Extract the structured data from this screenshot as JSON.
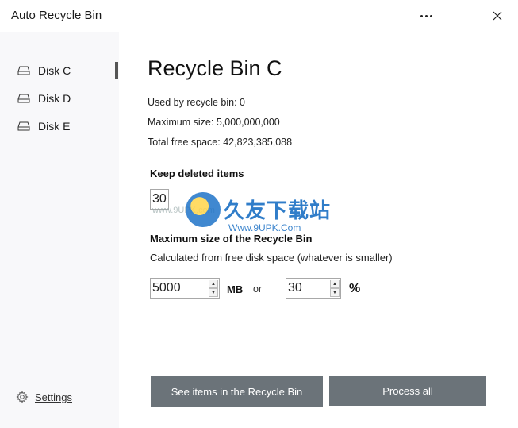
{
  "window": {
    "title": "Auto Recycle Bin",
    "more_icon": "more-horizontal-icon",
    "close_icon": "close-icon"
  },
  "sidebar": {
    "items": [
      {
        "label": "Disk C",
        "icon": "drive-icon",
        "active": true
      },
      {
        "label": "Disk D",
        "icon": "drive-icon",
        "active": false
      },
      {
        "label": "Disk E",
        "icon": "drive-icon",
        "active": false
      }
    ],
    "settings_label": "Settings",
    "settings_icon": "gear-icon"
  },
  "main": {
    "heading": "Recycle Bin C",
    "used": "Used by recycle bin: 0",
    "max_size": "Maximum size: 5,000,000,000",
    "free_space": "Total free space: 42,823,385,088",
    "keep_title": "Keep deleted items",
    "keep_value": "30",
    "max_title": "Maximum size of the Recycle Bin",
    "max_desc": "Calculated from free disk space (whatever is smaller)",
    "mb_value": "5000",
    "mb_unit": "MB",
    "or_text": "or",
    "percent_value": "30",
    "percent_unit": "%"
  },
  "buttons": {
    "see_items": "See items in the Recycle Bin",
    "process_all": "Process all"
  },
  "watermark": {
    "brand": "久友下载站",
    "url": "Www.9UPK.Com",
    "faint": "www.9UPK.com"
  },
  "colors": {
    "button_bg": "#6b7379",
    "sidebar_bg": "#f8f8fa",
    "active_indicator": "#555555",
    "watermark_blue": "#1a6fc4"
  }
}
